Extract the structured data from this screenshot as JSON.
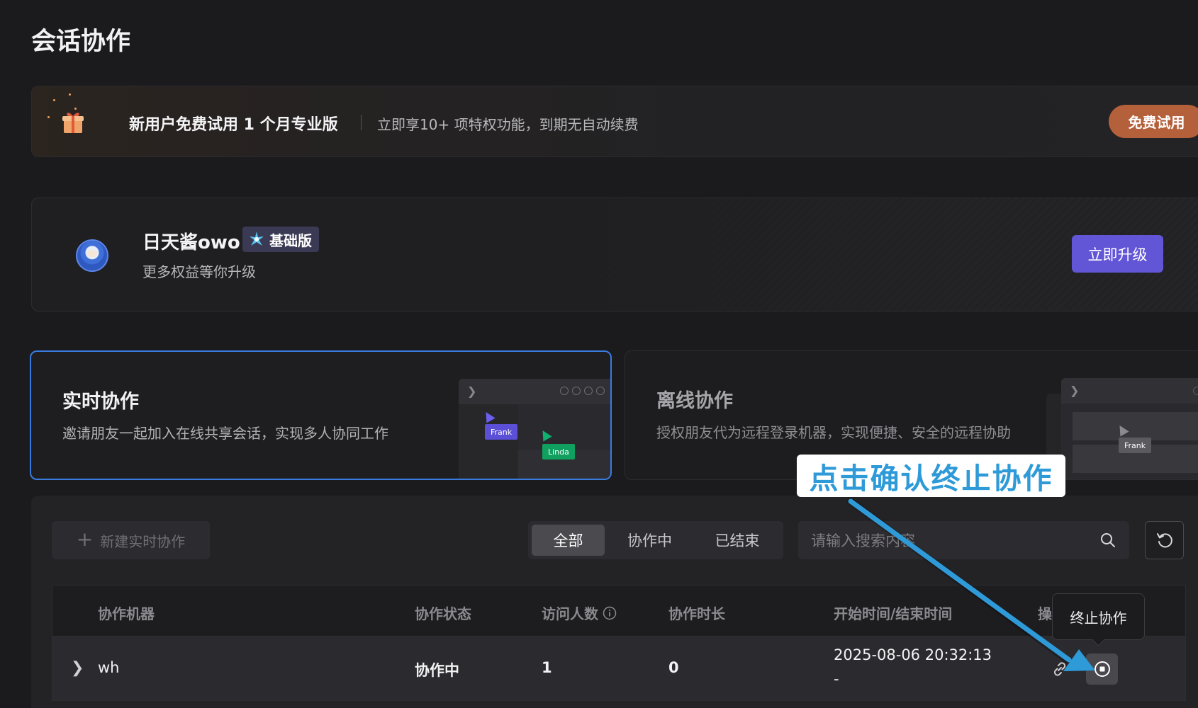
{
  "page": {
    "title": "会话协作"
  },
  "promo": {
    "title": "新用户免费试用 1 个月专业版",
    "description": "立即享10+ 项特权功能，到期无自动续费",
    "button": "免费试用"
  },
  "profile": {
    "username": "日天酱owo",
    "plan": "基础版",
    "subtitle": "更多权益等你升级",
    "upgrade_button": "立即升级"
  },
  "modes": {
    "realtime": {
      "title": "实时协作",
      "description": "邀请朋友一起加入在线共享会话，实现多人协同工作",
      "preview_tags": [
        "Frank",
        "Linda"
      ]
    },
    "offline": {
      "title": "离线协作",
      "description": "授权朋友代为远程登录机器，实现便捷、安全的远程协助",
      "preview_tags": [
        "Frank"
      ]
    }
  },
  "toolbar": {
    "new_button": "新建实时协作",
    "filters": [
      "全部",
      "协作中",
      "已结束"
    ],
    "active_filter": "全部",
    "search_placeholder": "请输入搜索内容"
  },
  "table": {
    "columns": [
      "协作机器",
      "协作状态",
      "访问人数",
      "协作时长",
      "开始时间/结束时间",
      "操作"
    ],
    "rows": [
      {
        "machine": "wh",
        "status": "协作中",
        "visitors": "1",
        "duration": "0",
        "start_time": "2025-08-06 20:32:13",
        "end_time": "-"
      }
    ]
  },
  "tooltip": {
    "text": "终止协作"
  },
  "annotation": {
    "callout": "点击确认终止协作",
    "color": "#2f9ad8"
  },
  "colors": {
    "accent_blue": "#3a7be0",
    "upgrade_purple": "#6356d6",
    "trial_orange": "#b4603a",
    "frank_tag": "#5a4fd6",
    "linda_tag": "#10a060"
  },
  "icons": [
    "gift-icon",
    "plan-star-icon",
    "plus-icon",
    "search-icon",
    "refresh-icon",
    "chevron-right-icon",
    "info-icon",
    "link-icon",
    "stop-icon"
  ]
}
